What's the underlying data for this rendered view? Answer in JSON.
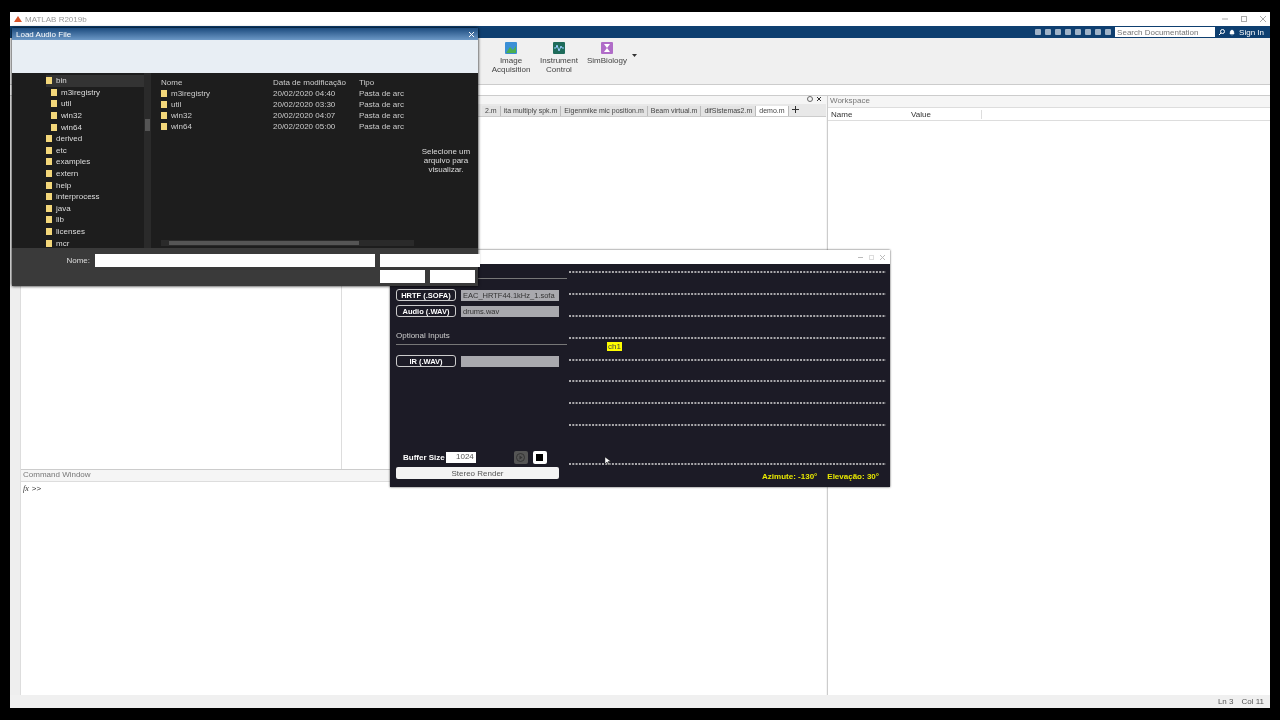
{
  "matlab": {
    "title": "MATLAB R2019b",
    "search": {
      "placeholder": "Search Documentation"
    },
    "sign_in": "Sign In",
    "apps": [
      {
        "label": "Image Acquisition",
        "kind": "image"
      },
      {
        "label": "Instrument Control",
        "kind": "instrument"
      },
      {
        "label": "SimBiology",
        "kind": "bio"
      }
    ],
    "editor_tabs": [
      {
        "label": "2.m",
        "selected": false
      },
      {
        "label": "ita multiply spk.m",
        "selected": false
      },
      {
        "label": "Eigenmike mic position.m",
        "selected": false
      },
      {
        "label": "Beam virtual.m",
        "selected": false
      },
      {
        "label": "difSistemas2.m",
        "selected": false
      },
      {
        "label": "demo.m",
        "selected": true
      }
    ],
    "workspace": {
      "title": "Workspace",
      "columns": [
        "Name",
        "Value"
      ]
    },
    "command_window": {
      "title": "Command Window",
      "fx": "fx",
      "prompt": ">>"
    },
    "status": {
      "line": "Ln 3",
      "col": "Col 11"
    }
  },
  "dialog": {
    "title": "Load Audio File",
    "tree": [
      {
        "label": "bin",
        "selected": true,
        "children": [
          {
            "label": "m3iregistry",
            "selected": false
          },
          {
            "label": "util",
            "selected": false
          },
          {
            "label": "win32",
            "selected": false
          },
          {
            "label": "win64",
            "selected": false
          }
        ]
      },
      {
        "label": "derived",
        "selected": false
      },
      {
        "label": "etc",
        "selected": false
      },
      {
        "label": "examples",
        "selected": false
      },
      {
        "label": "extern",
        "selected": false
      },
      {
        "label": "help",
        "selected": false
      },
      {
        "label": "interprocess",
        "selected": false
      },
      {
        "label": "java",
        "selected": false
      },
      {
        "label": "lib",
        "selected": false
      },
      {
        "label": "licenses",
        "selected": false
      },
      {
        "label": "mcr",
        "selected": false
      }
    ],
    "columns": [
      "Nome",
      "Data de modificação",
      "Tipo"
    ],
    "files": [
      {
        "name": "m3iregistry",
        "modified": "20/02/2020 04:40",
        "type": "Pasta de arc"
      },
      {
        "name": "util",
        "modified": "20/02/2020 03:30",
        "type": "Pasta de arc"
      },
      {
        "name": "win32",
        "modified": "20/02/2020 04:07",
        "type": "Pasta de arc"
      },
      {
        "name": "win64",
        "modified": "20/02/2020 05:00",
        "type": "Pasta de arc"
      }
    ],
    "preview_hint": "Selecione um arquivo para visualizar.",
    "name_label": "Nome:"
  },
  "renderer": {
    "inputs": [
      {
        "label": "HRTF (.SOFA)",
        "value": "EAC_HRTF44.1kHz_1.sofa"
      },
      {
        "label": "Audio (.WAV)",
        "value": "drums.wav"
      }
    ],
    "optional_title": "Optional Inputs",
    "optional_inputs": [
      {
        "label": "IR (.WAV)"
      }
    ],
    "buffer_label": "Buffer Size",
    "buffer_value": "1024",
    "play": {
      "disabled": true
    },
    "render_button": "Stereo Render",
    "channel_label": "ch1",
    "azimuth": "Azimute: -130°",
    "elevation": "Elevação: 30°"
  }
}
